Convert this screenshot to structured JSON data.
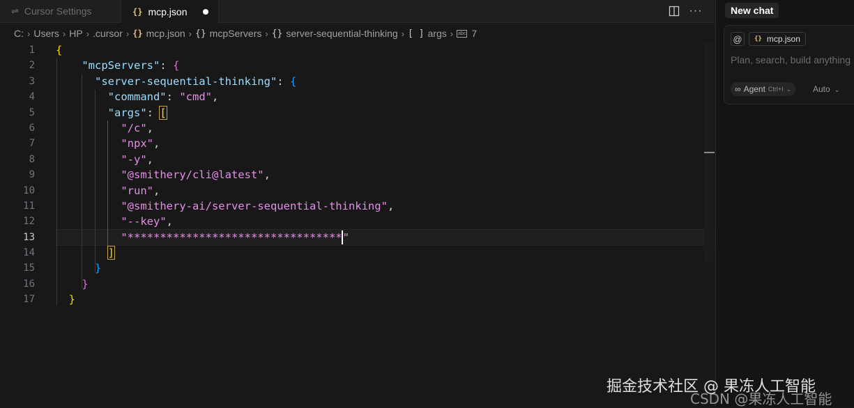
{
  "tabs": [
    {
      "icon": "settings-icon",
      "label": "Cursor Settings"
    },
    {
      "icon": "{}",
      "label": "mcp.json",
      "modified": true
    }
  ],
  "breadcrumb": {
    "drive": "C:",
    "items": [
      "Users",
      "HP",
      ".cursor"
    ],
    "file": "mcp.json",
    "symbols": [
      "mcpServers",
      "server-sequential-thinking",
      "args"
    ],
    "leaf": "7"
  },
  "editor": {
    "current_line": 13,
    "line_numbers": [
      "1",
      "2",
      "3",
      "4",
      "5",
      "6",
      "7",
      "8",
      "9",
      "10",
      "11",
      "12",
      "13",
      "14",
      "15",
      "16",
      "17"
    ],
    "keys": {
      "mcpServers": "\"mcpServers\"",
      "server": "\"server-sequential-thinking\"",
      "command": "\"command\"",
      "args": "\"args\""
    },
    "values": {
      "command": "\"cmd\"",
      "arg1": "\"/c\"",
      "arg2": "\"npx\"",
      "arg3": "\"-y\"",
      "arg4": "\"@smithery/cli@latest\"",
      "arg5": "\"run\"",
      "arg6": "\"@smithery-ai/server-sequential-thinking\"",
      "arg7": "\"--key\"",
      "arg8": "\"*********************************"
    },
    "closing_quote": "\"",
    "colors": {
      "key": "#9cdcfe",
      "string": "#e58ee8",
      "bracket1": "#ffd700",
      "bracket2": "#da70d6",
      "bracket3": "#179fff"
    }
  },
  "chat_panel": {
    "new_chat_label": "New chat",
    "context_chip": "mcp.json",
    "placeholder": "Plan, search, build anything",
    "mode_label": "Agent",
    "mode_shortcut": "Ctrl+I",
    "model_label": "Auto"
  },
  "watermark": {
    "line1": "掘金技术社区 @ 果冻人工智能",
    "line2": "CSDN @果冻人工智能"
  }
}
